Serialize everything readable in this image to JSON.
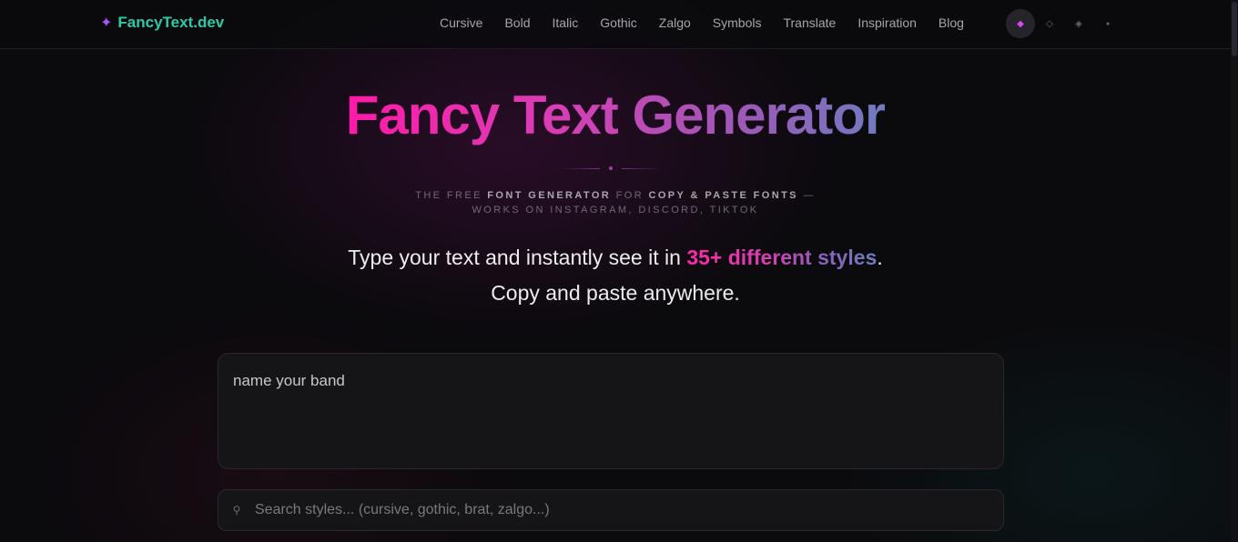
{
  "header": {
    "logo_icon": "sparkle-icon",
    "logo_glyph": "✦",
    "logo_text": "FancyText.dev",
    "nav": [
      "Cursive",
      "Bold",
      "Italic",
      "Gothic",
      "Zalgo",
      "Symbols",
      "Translate",
      "Inspiration",
      "Blog"
    ],
    "theme_options": [
      {
        "icon": "diamond-filled-icon",
        "glyph": "◆",
        "active": true
      },
      {
        "icon": "diamond-outline-icon",
        "glyph": "◇",
        "active": false
      },
      {
        "icon": "diamond-dotted-icon",
        "glyph": "◈",
        "active": false
      },
      {
        "icon": "dot-icon",
        "glyph": "●",
        "active": false
      }
    ]
  },
  "hero": {
    "title": "Fancy Text Generator",
    "tagline_parts": [
      "THE FREE ",
      "FONT GENERATOR",
      " FOR ",
      "COPY & PASTE FONTS",
      " —"
    ],
    "tagline_line2": "WORKS ON INSTAGRAM, DISCORD, TIKTOK",
    "intro_before": "Type your text and instantly see it in ",
    "intro_highlight": "35+ different styles",
    "intro_after": ". Copy and paste anywhere."
  },
  "input": {
    "value": "name your band"
  },
  "search": {
    "icon": "search-icon",
    "glyph": "⚲",
    "placeholder": "Search styles... (cursive, gothic, brat, zalgo...)"
  },
  "colors": {
    "accent_pink": "#ff1aa8",
    "accent_purple": "#a855f7",
    "logo_teal": "#2ec9a8",
    "background": "#0b0a0d"
  }
}
